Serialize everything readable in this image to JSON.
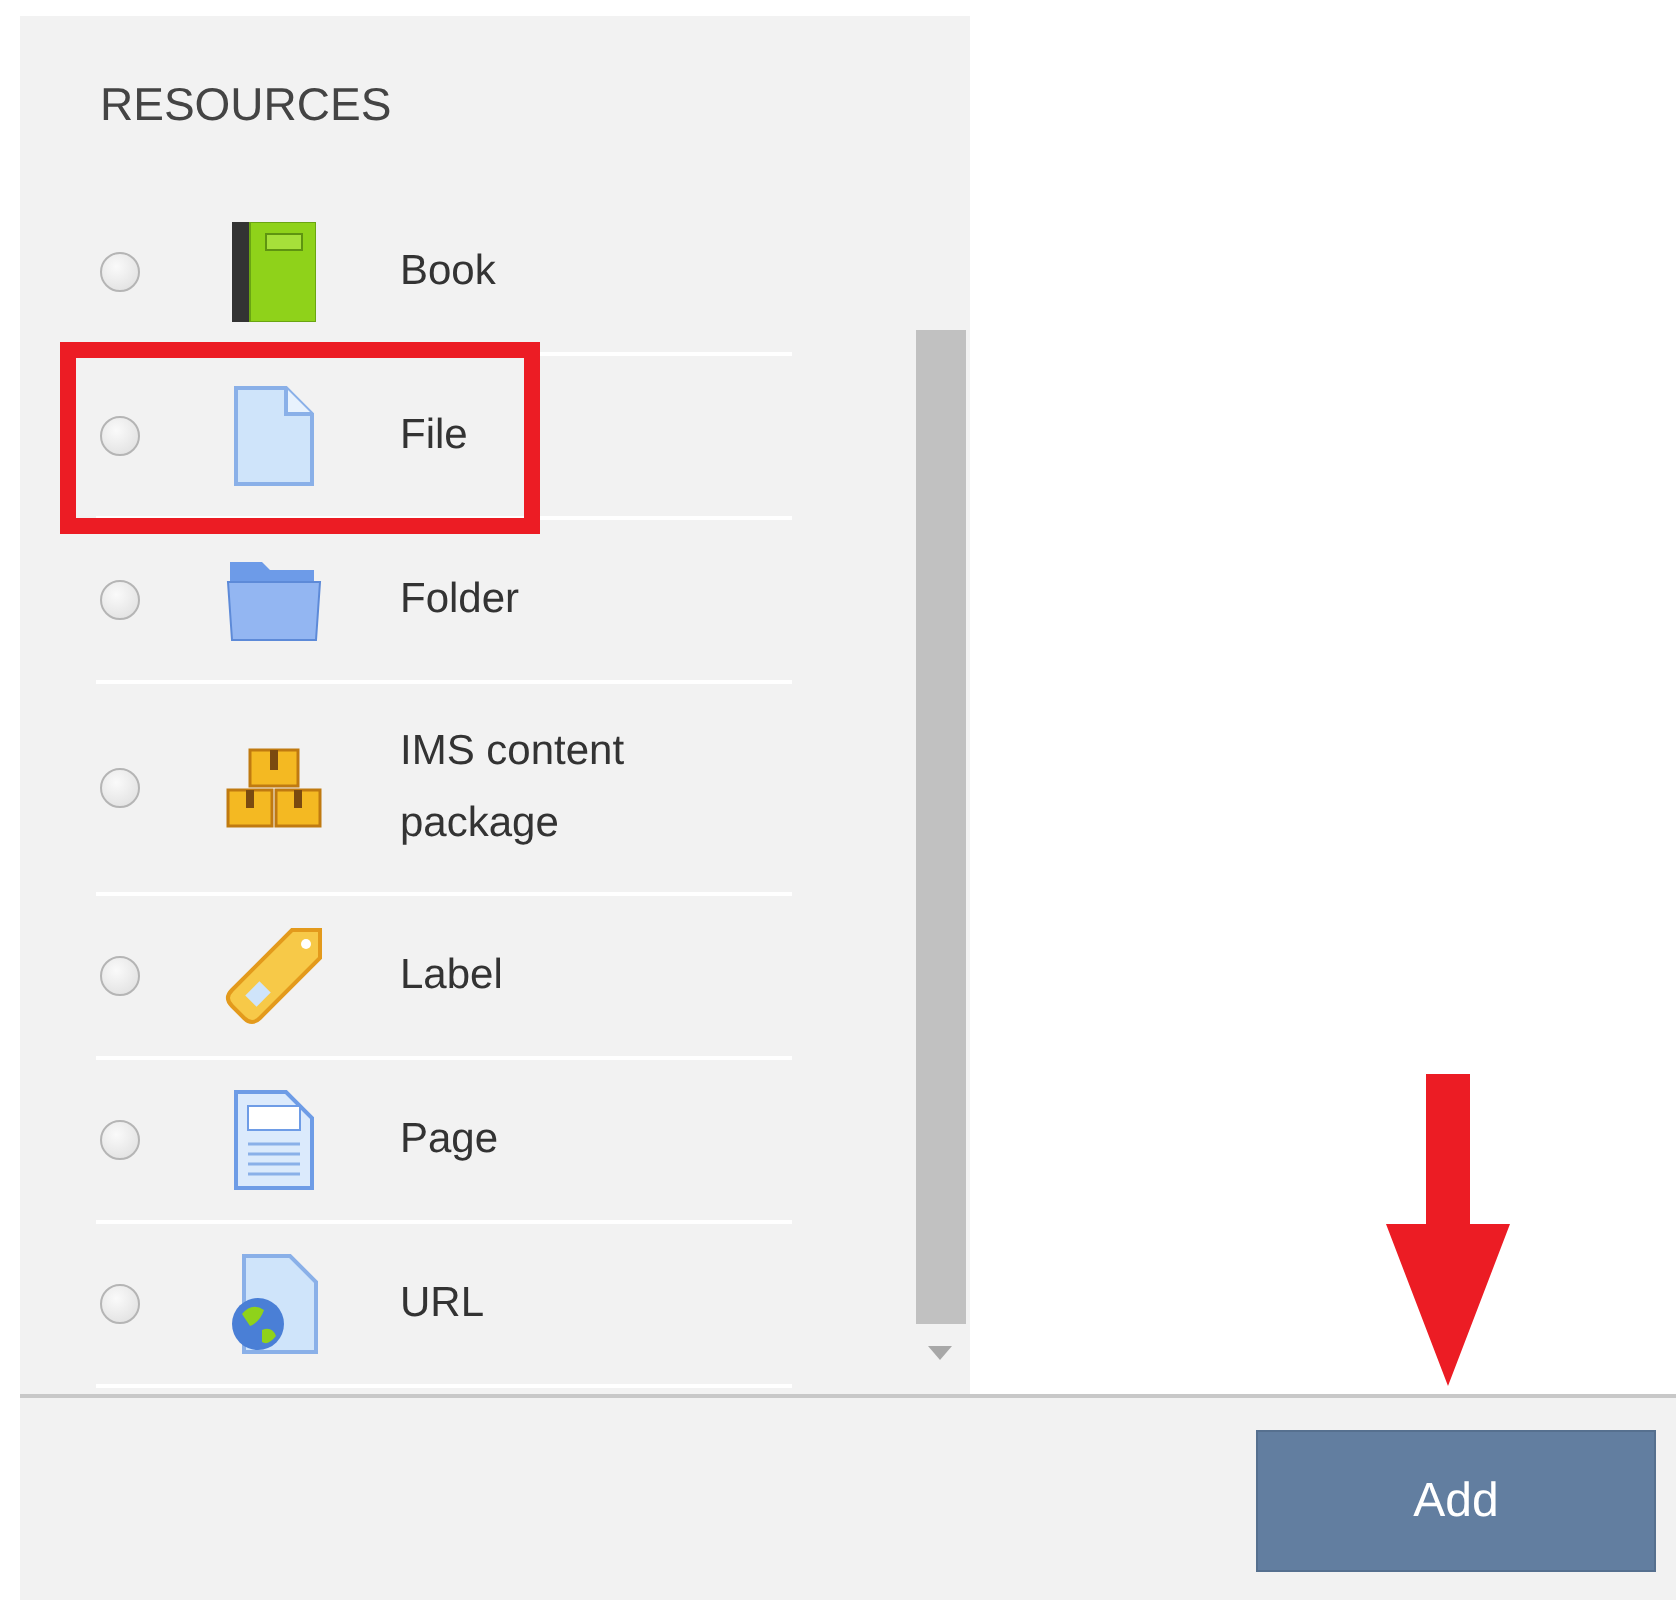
{
  "section": {
    "heading": "RESOURCES"
  },
  "items": [
    {
      "kind": "book",
      "label": "Book",
      "selected": false,
      "highlighted": false
    },
    {
      "kind": "file",
      "label": "File",
      "selected": false,
      "highlighted": true
    },
    {
      "kind": "folder",
      "label": "Folder",
      "selected": false,
      "highlighted": false
    },
    {
      "kind": "package",
      "label": "IMS content package",
      "selected": false,
      "highlighted": false
    },
    {
      "kind": "label",
      "label": "Label",
      "selected": false,
      "highlighted": false
    },
    {
      "kind": "page",
      "label": "Page",
      "selected": false,
      "highlighted": false
    },
    {
      "kind": "url",
      "label": "URL",
      "selected": false,
      "highlighted": false
    }
  ],
  "footer": {
    "button": "Add"
  }
}
